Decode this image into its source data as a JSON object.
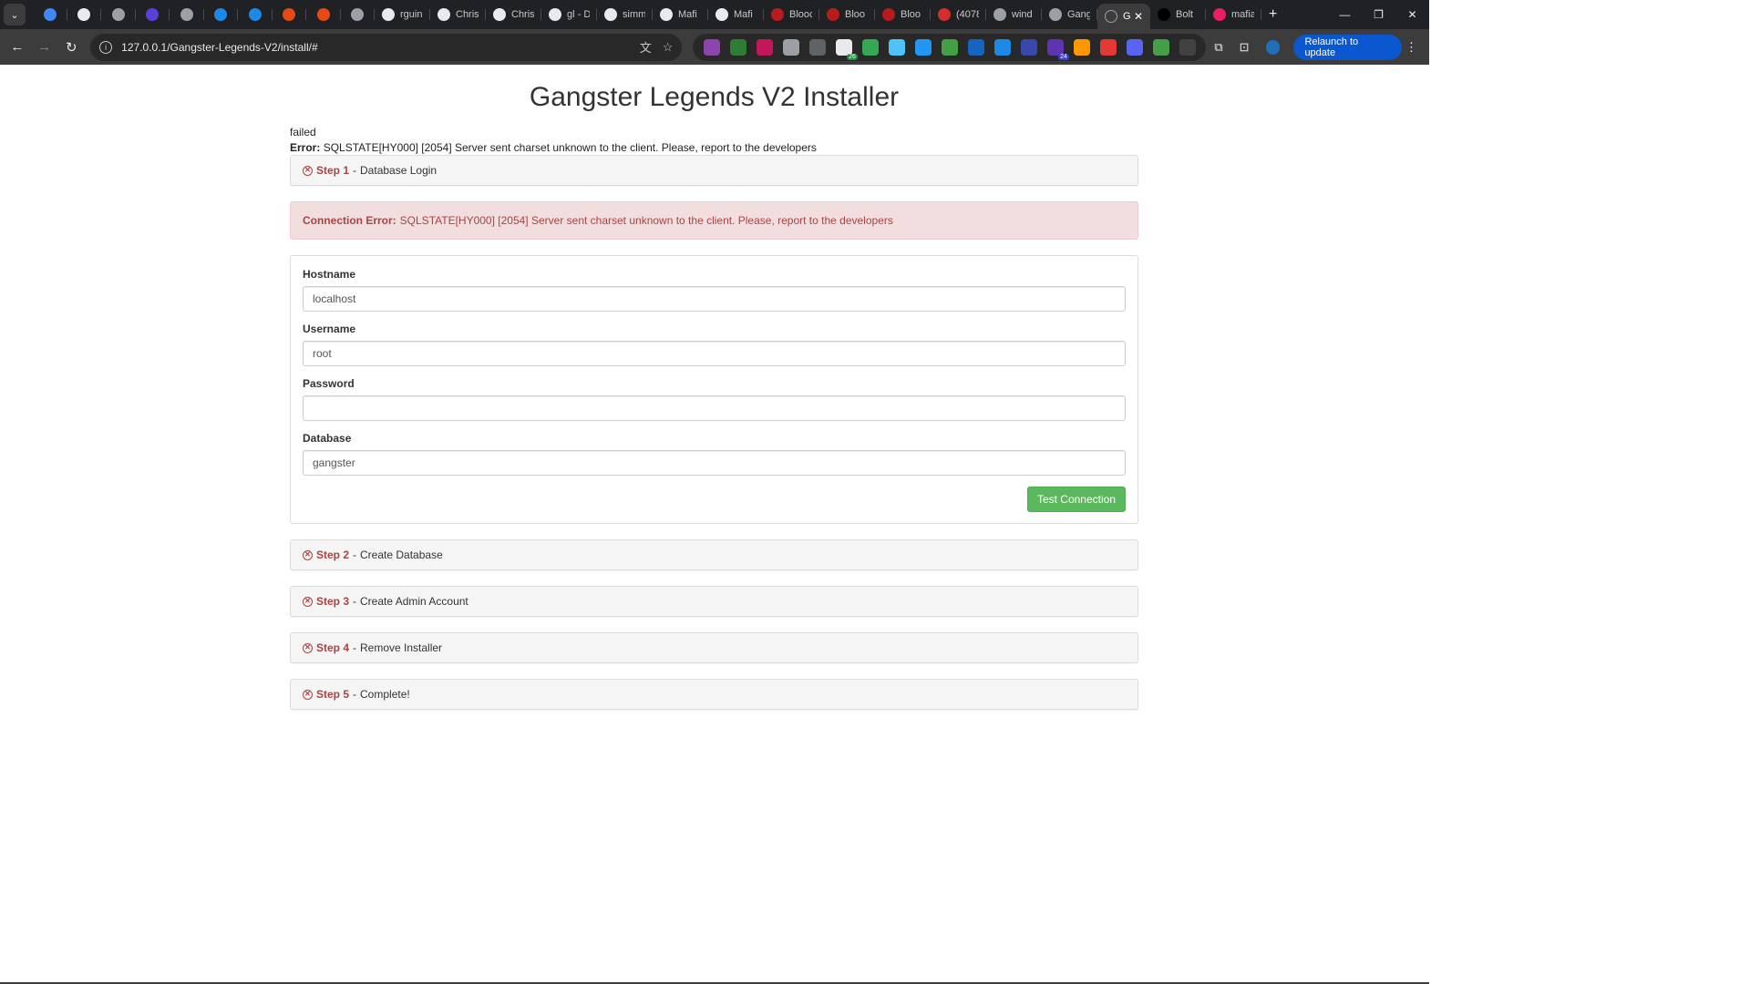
{
  "browser": {
    "tabs": [
      {
        "label": "",
        "icon": "gem-icon",
        "color": "#4285f4"
      },
      {
        "label": "",
        "icon": "github-icon",
        "color": "#e8eaed"
      },
      {
        "label": "",
        "icon": "globe-icon",
        "color": "#9aa0a6"
      },
      {
        "label": "",
        "icon": "app-icon",
        "color": "#5b3fd9"
      },
      {
        "label": "",
        "icon": "settings-globe-icon",
        "color": "#9aa0a6"
      },
      {
        "label": "",
        "icon": "c-icon",
        "color": "#1e88e5"
      },
      {
        "label": "",
        "icon": "c-icon",
        "color": "#1e88e5"
      },
      {
        "label": "",
        "icon": "shield-icon",
        "color": "#e64a19"
      },
      {
        "label": "",
        "icon": "shield-icon",
        "color": "#e64a19"
      },
      {
        "label": "",
        "icon": "page-icon",
        "color": "#9aa0a6"
      },
      {
        "label": "rguin",
        "icon": "github-icon",
        "color": "#e8eaed"
      },
      {
        "label": "Chris",
        "icon": "github-icon",
        "color": "#e8eaed"
      },
      {
        "label": "Chris",
        "icon": "github-icon",
        "color": "#e8eaed"
      },
      {
        "label": "gl - D",
        "icon": "chart-icon",
        "color": "#e8eaed"
      },
      {
        "label": "simm",
        "icon": "github-icon",
        "color": "#e8eaed"
      },
      {
        "label": "Mafi",
        "icon": "github-icon",
        "color": "#e8eaed"
      },
      {
        "label": "Mafi",
        "icon": "github-icon",
        "color": "#e8eaed"
      },
      {
        "label": "Blooc",
        "icon": "blood-icon",
        "color": "#b71c1c"
      },
      {
        "label": "Bloo",
        "icon": "blood-icon",
        "color": "#b71c1c"
      },
      {
        "label": "Bloo",
        "icon": "blood-icon",
        "color": "#b71c1c"
      },
      {
        "label": "(4078",
        "icon": "reddit-icon",
        "color": "#d32f2f"
      },
      {
        "label": "wind",
        "icon": "globe-icon",
        "color": "#9aa0a6"
      },
      {
        "label": "Gang",
        "icon": "globe-icon",
        "color": "#9aa0a6"
      }
    ],
    "active_tab": {
      "label": "G",
      "icon": "globe-icon",
      "color": "#9aa0a6"
    },
    "tabs_after": [
      {
        "label": "Bolt",
        "icon": "bolt-icon",
        "color": "#000000"
      },
      {
        "label": "mafia",
        "icon": "lovable-icon",
        "color": "#e91e63"
      }
    ],
    "url": "127.0.0.1/Gangster-Legends-V2/install/#",
    "relaunch_label": "Relaunch to update",
    "extensions": [
      {
        "name": "puzzle-gear-ext-icon",
        "color": "#8e44ad"
      },
      {
        "name": "dark-ext-icon",
        "color": "#2e7d32"
      },
      {
        "name": "red-circle-ext-icon",
        "color": "#c2185b"
      },
      {
        "name": "printer-ext-icon",
        "color": "#9aa0a6"
      },
      {
        "name": "outline-ext-icon",
        "color": "#5f6368"
      },
      {
        "name": "calendar-ext-icon",
        "color": "#e8eaed",
        "badge": "26"
      },
      {
        "name": "send-ext-icon",
        "color": "#34a853"
      },
      {
        "name": "grid-ext-icon",
        "color": "#4fc3f7"
      },
      {
        "name": "gem-ext-icon",
        "color": "#2196f3"
      },
      {
        "name": "leaf-ext-icon",
        "color": "#43a047"
      },
      {
        "name": "translate-ext-icon",
        "color": "#1565c0"
      },
      {
        "name": "fb-ext-icon",
        "color": "#1e88e5"
      },
      {
        "name": "table-ext-icon",
        "color": "#3949ab"
      },
      {
        "name": "purple-ext-icon",
        "color": "#5e35b1",
        "badge": "24"
      },
      {
        "name": "qq-ext-icon",
        "color": "#ff9800"
      },
      {
        "name": "hand-ext-icon",
        "color": "#e53935"
      },
      {
        "name": "discord-ext-icon",
        "color": "#5865f2"
      },
      {
        "name": "shield-ext-icon",
        "color": "#43a047"
      },
      {
        "name": "blank-ext-icon",
        "color": "#424242"
      }
    ]
  },
  "page": {
    "title": "Gangster Legends V2 Installer",
    "status": "failed",
    "error_label": "Error:",
    "error_text": "SQLSTATE[HY000] [2054] Server sent charset unknown to the client. Please, report to the developers",
    "alert_label": "Connection Error:",
    "alert_text": "SQLSTATE[HY000] [2054] Server sent charset unknown to the client. Please, report to the developers",
    "step1": {
      "num": "Step 1",
      "sep": "-",
      "title": "Database Login"
    },
    "form": {
      "hostname_label": "Hostname",
      "hostname_value": "localhost",
      "username_label": "Username",
      "username_value": "root",
      "password_label": "Password",
      "password_value": "",
      "database_label": "Database",
      "database_value": "gangster",
      "button_label": "Test Connection"
    },
    "steps": [
      {
        "num": "Step 2",
        "sep": "-",
        "title": "Create Database"
      },
      {
        "num": "Step 3",
        "sep": "-",
        "title": "Create Admin Account"
      },
      {
        "num": "Step 4",
        "sep": "-",
        "title": "Remove Installer"
      },
      {
        "num": "Step 5",
        "sep": "-",
        "title": "Complete!"
      }
    ],
    "status_color": "#a94442",
    "success_color": "#5cb85c"
  }
}
